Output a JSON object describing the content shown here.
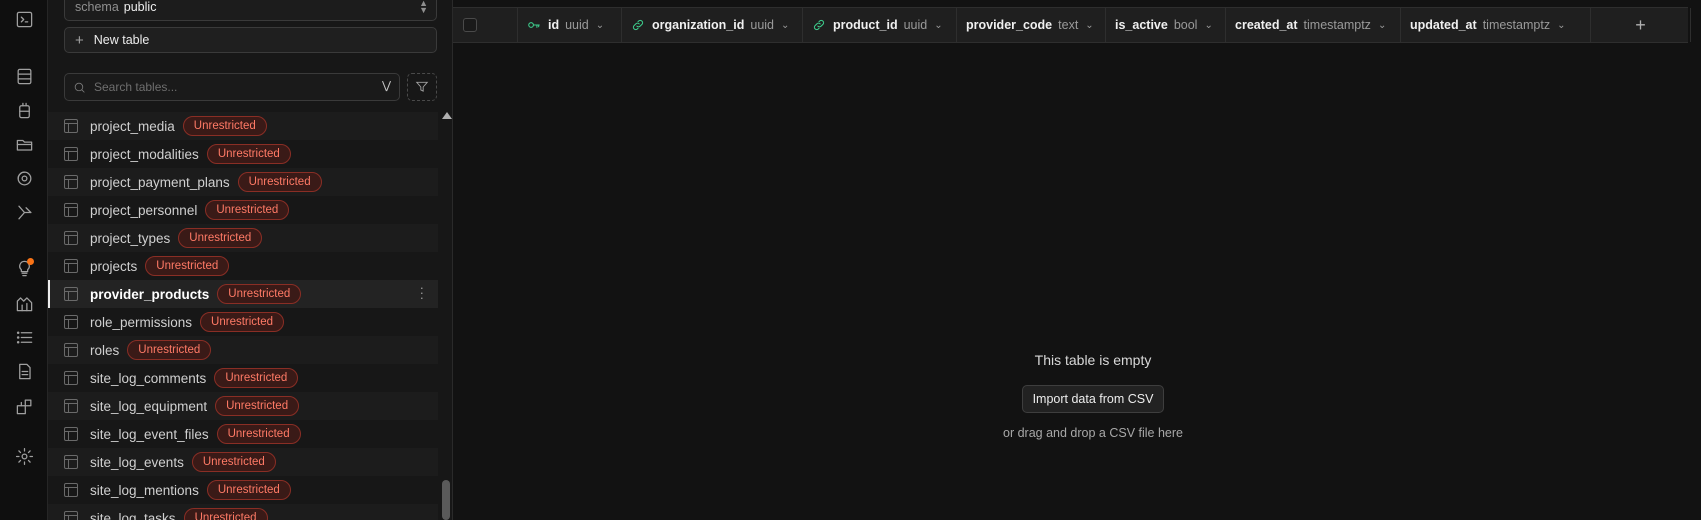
{
  "rail": {
    "icons": [
      "terminal-icon",
      "table-editor-icon",
      "database-icon",
      "storage-icon",
      "realtime-icon",
      "edge-functions-icon",
      "advisors-icon",
      "reports-icon",
      "logs-icon",
      "api-docs-icon",
      "integrations-icon",
      "settings-icon"
    ],
    "notification_color": "#f97316"
  },
  "sidebar": {
    "schema_label": "schema",
    "schema_value": "public",
    "new_table_label": "New table",
    "search_placeholder": "Search tables...",
    "badge_text": "Unrestricted",
    "tables": [
      {
        "name": "project_media",
        "badge": "Unrestricted"
      },
      {
        "name": "project_modalities",
        "badge": "Unrestricted"
      },
      {
        "name": "project_payment_plans",
        "badge": "Unrestricted"
      },
      {
        "name": "project_personnel",
        "badge": "Unrestricted"
      },
      {
        "name": "project_types",
        "badge": "Unrestricted"
      },
      {
        "name": "projects",
        "badge": "Unrestricted"
      },
      {
        "name": "provider_products",
        "badge": "Unrestricted",
        "active": true
      },
      {
        "name": "role_permissions",
        "badge": "Unrestricted"
      },
      {
        "name": "roles",
        "badge": "Unrestricted"
      },
      {
        "name": "site_log_comments",
        "badge": "Unrestricted"
      },
      {
        "name": "site_log_equipment",
        "badge": "Unrestricted"
      },
      {
        "name": "site_log_event_files",
        "badge": "Unrestricted"
      },
      {
        "name": "site_log_events",
        "badge": "Unrestricted"
      },
      {
        "name": "site_log_mentions",
        "badge": "Unrestricted"
      },
      {
        "name": "site_log_tasks",
        "badge": "Unrestricted"
      }
    ]
  },
  "grid": {
    "columns": [
      {
        "name": "id",
        "type": "uuid",
        "icon": "key-icon"
      },
      {
        "name": "organization_id",
        "type": "uuid",
        "icon": "link-icon"
      },
      {
        "name": "product_id",
        "type": "uuid",
        "icon": "link-icon"
      },
      {
        "name": "provider_code",
        "type": "text",
        "icon": ""
      },
      {
        "name": "is_active",
        "type": "bool",
        "icon": ""
      },
      {
        "name": "created_at",
        "type": "timestamptz",
        "icon": ""
      },
      {
        "name": "updated_at",
        "type": "timestamptz",
        "icon": ""
      }
    ],
    "add_column_label": "+",
    "accent_color": "#3ecf8e"
  },
  "empty_state": {
    "title": "This table is empty",
    "import_button": "Import data from CSV",
    "hint": "or drag and drop a CSV file here"
  }
}
